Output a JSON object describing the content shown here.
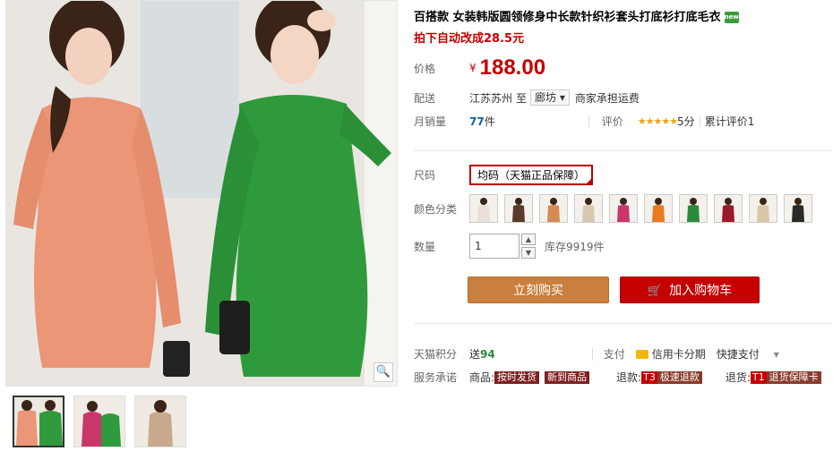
{
  "product": {
    "title": "百搭款 女装韩版圆领修身中长款针织衫套头打底衫打底毛衣",
    "subtitle": "拍下自动改成28.5元",
    "new_badge": "new"
  },
  "price": {
    "label": "价格",
    "currency": "¥",
    "value": "188.00"
  },
  "delivery": {
    "label": "配送",
    "from": "江苏苏州",
    "to_word": "至",
    "city": "廊坊",
    "note": "商家承担运费"
  },
  "sales": {
    "label": "月销量",
    "count": "77",
    "unit": "件",
    "rating_label": "评价",
    "stars": "★★★★★",
    "score": "5分",
    "total_reviews": "累计评价1"
  },
  "size": {
    "label": "尺码",
    "option": "均码（天猫正品保障）"
  },
  "color": {
    "label": "颜色分类",
    "swatches": [
      "#e8e0d8",
      "#5a3a2a",
      "#d48a50",
      "#d8c8b0",
      "#c8366a",
      "#e87a20",
      "#2a8a3a",
      "#9a1a2a",
      "#d8c8a8",
      "#2a2a2a"
    ]
  },
  "quantity": {
    "label": "数量",
    "value": "1",
    "stock": "库存9919件",
    "up": "▲",
    "down": "▼"
  },
  "buttons": {
    "buy": "立刻购买",
    "cart": "加入购物车",
    "cart_icon": "🛒"
  },
  "points": {
    "label": "天猫积分",
    "value_prefix": "送",
    "value": "94"
  },
  "payment": {
    "label": "支付",
    "credit": "信用卡分期",
    "quick": "快捷支付"
  },
  "service": {
    "label": "服务承诺",
    "goods_label": "商品:",
    "goods_tags": [
      "按时发货",
      "新到商品"
    ],
    "return_label": "退款:",
    "return_t": "T3",
    "return_text": "极速退款",
    "exchange_label": "退货:",
    "exchange_t": "T1",
    "exchange_text": "退货保障卡"
  },
  "zoom_icon": "🔍"
}
